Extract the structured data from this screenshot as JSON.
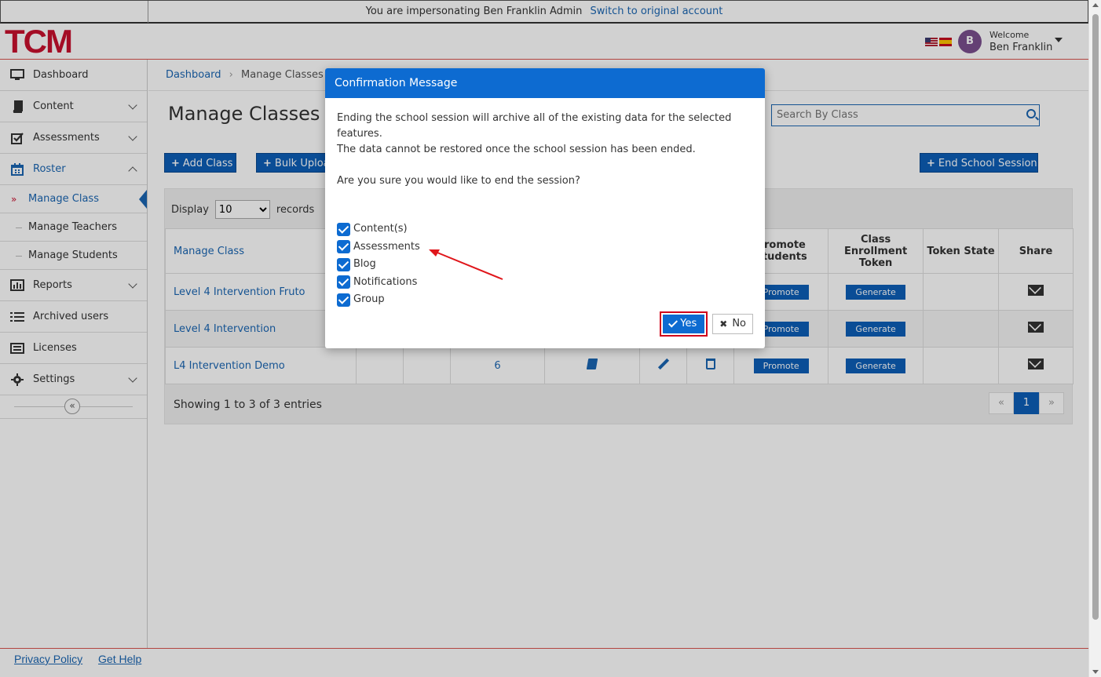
{
  "impersonation": {
    "text": "You are impersonating Ben Franklin Admin",
    "link": "Switch to original account"
  },
  "header": {
    "logo": "TCM",
    "avatar_initial": "B",
    "welcome": "Welcome",
    "user_name": "Ben Franklin"
  },
  "sidebar": {
    "items": [
      {
        "label": "Dashboard",
        "icon": "monitor-icon"
      },
      {
        "label": "Content",
        "icon": "book-icon"
      },
      {
        "label": "Assessments",
        "icon": "checkbox-icon"
      },
      {
        "label": "Roster",
        "icon": "calendar-icon"
      },
      {
        "label": "Reports",
        "icon": "bar-chart-icon"
      },
      {
        "label": "Archived users",
        "icon": "list-icon"
      },
      {
        "label": "Licenses",
        "icon": "license-icon"
      },
      {
        "label": "Settings",
        "icon": "gear-icon"
      }
    ],
    "roster_sub": [
      "Manage Class",
      "Manage Teachers",
      "Manage Students"
    ]
  },
  "breadcrumb": {
    "home": "Dashboard",
    "current": "Manage Classes"
  },
  "page_title": "Manage Classes",
  "search": {
    "placeholder": "Search By Class"
  },
  "buttons": {
    "add_class": "Add Class",
    "bulk_upload": "Bulk Upload",
    "end_session": "End School Session"
  },
  "display": {
    "label": "Display",
    "value": "10",
    "suffix": "records"
  },
  "table": {
    "first_header": "Manage Class",
    "headers_right": [
      "Promote Students",
      "Class Enrollment Token",
      "Token State",
      "Share"
    ],
    "rows": [
      {
        "name": "Level 4 Intervention Fruto",
        "promote": "Promote",
        "token": "Generate"
      },
      {
        "name": "Level 4 Intervention",
        "promote": "Promote",
        "token": "Generate"
      },
      {
        "name": "L4 Intervention Demo",
        "count": "6",
        "promote": "Promote",
        "token": "Generate"
      }
    ]
  },
  "showing": "Showing 1 to 3 of 3 entries",
  "pager": {
    "prev": "«",
    "current": "1",
    "next": "»"
  },
  "modal": {
    "title": "Confirmation Message",
    "line1": "Ending the school session will archive all of the existing data for the selected features.",
    "line2": "The data cannot be restored once the school session has been ended.",
    "question": "Are you sure you would like to end the session?",
    "options": [
      "Content(s)",
      "Assessments",
      "Blog",
      "Notifications",
      "Group"
    ],
    "yes": "Yes",
    "no": "No"
  },
  "footer": {
    "privacy": "Privacy Policy",
    "help": "Get Help"
  }
}
